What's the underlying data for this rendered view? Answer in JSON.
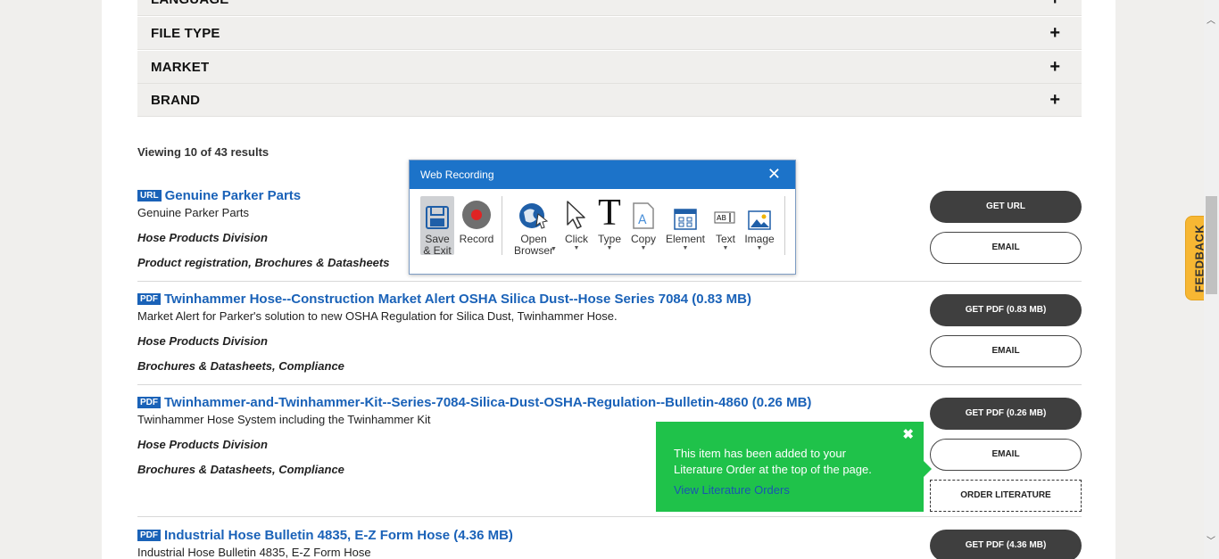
{
  "filters": [
    {
      "label": "LANGUAGE",
      "icon": "+"
    },
    {
      "label": "FILE TYPE",
      "icon": "+"
    },
    {
      "label": "MARKET",
      "icon": "+"
    },
    {
      "label": "BRAND",
      "icon": "+"
    }
  ],
  "results_summary": "Viewing 10 of 43 results",
  "results": [
    {
      "badge": "URL",
      "title": "Genuine Parker Parts",
      "description": "Genuine Parker Parts",
      "division": "Hose Products Division",
      "categories": "Product registration, Brochures & Datasheets",
      "primary_button": "GET URL",
      "email_button": "EMAIL"
    },
    {
      "badge": "PDF",
      "title": "Twinhammer Hose--Construction Market Alert OSHA Silica Dust--Hose Series 7084 (0.83 MB)",
      "description": "Market Alert for Parker's solution to new OSHA Regulation for Silica Dust, Twinhammer Hose.",
      "division": "Hose Products Division",
      "categories": "Brochures & Datasheets, Compliance",
      "primary_button": "GET PDF (0.83 MB)",
      "email_button": "EMAIL"
    },
    {
      "badge": "PDF",
      "title": "Twinhammer-and-Twinhammer-Kit--Series-7084-Silica-Dust-OSHA-Regulation--Bulletin-4860 (0.26 MB)",
      "description": "Twinhammer Hose System including the Twinhammer Kit",
      "division": "Hose Products Division",
      "categories": "Brochures & Datasheets, Compliance",
      "primary_button": "GET PDF (0.26 MB)",
      "email_button": "EMAIL",
      "order_button": "ORDER LITERATURE"
    },
    {
      "badge": "PDF",
      "title": "Industrial Hose Bulletin 4835, E-Z Form Hose (4.36 MB)",
      "description": "Industrial Hose Bulletin 4835, E-Z Form Hose",
      "primary_button": "GET PDF (4.36 MB)"
    }
  ],
  "recorder": {
    "title": "Web Recording",
    "tools": [
      {
        "label": "Save & Exit",
        "icon": "floppy-disk-icon"
      },
      {
        "label": "Record",
        "icon": "record-icon"
      },
      {
        "label": "Open Browser",
        "icon": "globe-cursor-icon"
      },
      {
        "label": "Click",
        "icon": "pointer-icon"
      },
      {
        "label": "Type",
        "icon": "type-icon"
      },
      {
        "label": "Copy",
        "icon": "copy-icon"
      },
      {
        "label": "Element",
        "icon": "element-icon"
      },
      {
        "label": "Text",
        "icon": "text-icon"
      },
      {
        "label": "Image",
        "icon": "image-icon"
      }
    ]
  },
  "toast": {
    "message": "This item has been added to your Literature Order at the top of the page.",
    "link": "View Literature Orders",
    "close": "✖"
  },
  "feedback_tab": "FEEDBACK",
  "colors": {
    "link_blue": "#1a62b8",
    "toast_green": "#1fc24a",
    "recorder_blue": "#1c73c9",
    "feedback_orange": "#f7b733"
  }
}
